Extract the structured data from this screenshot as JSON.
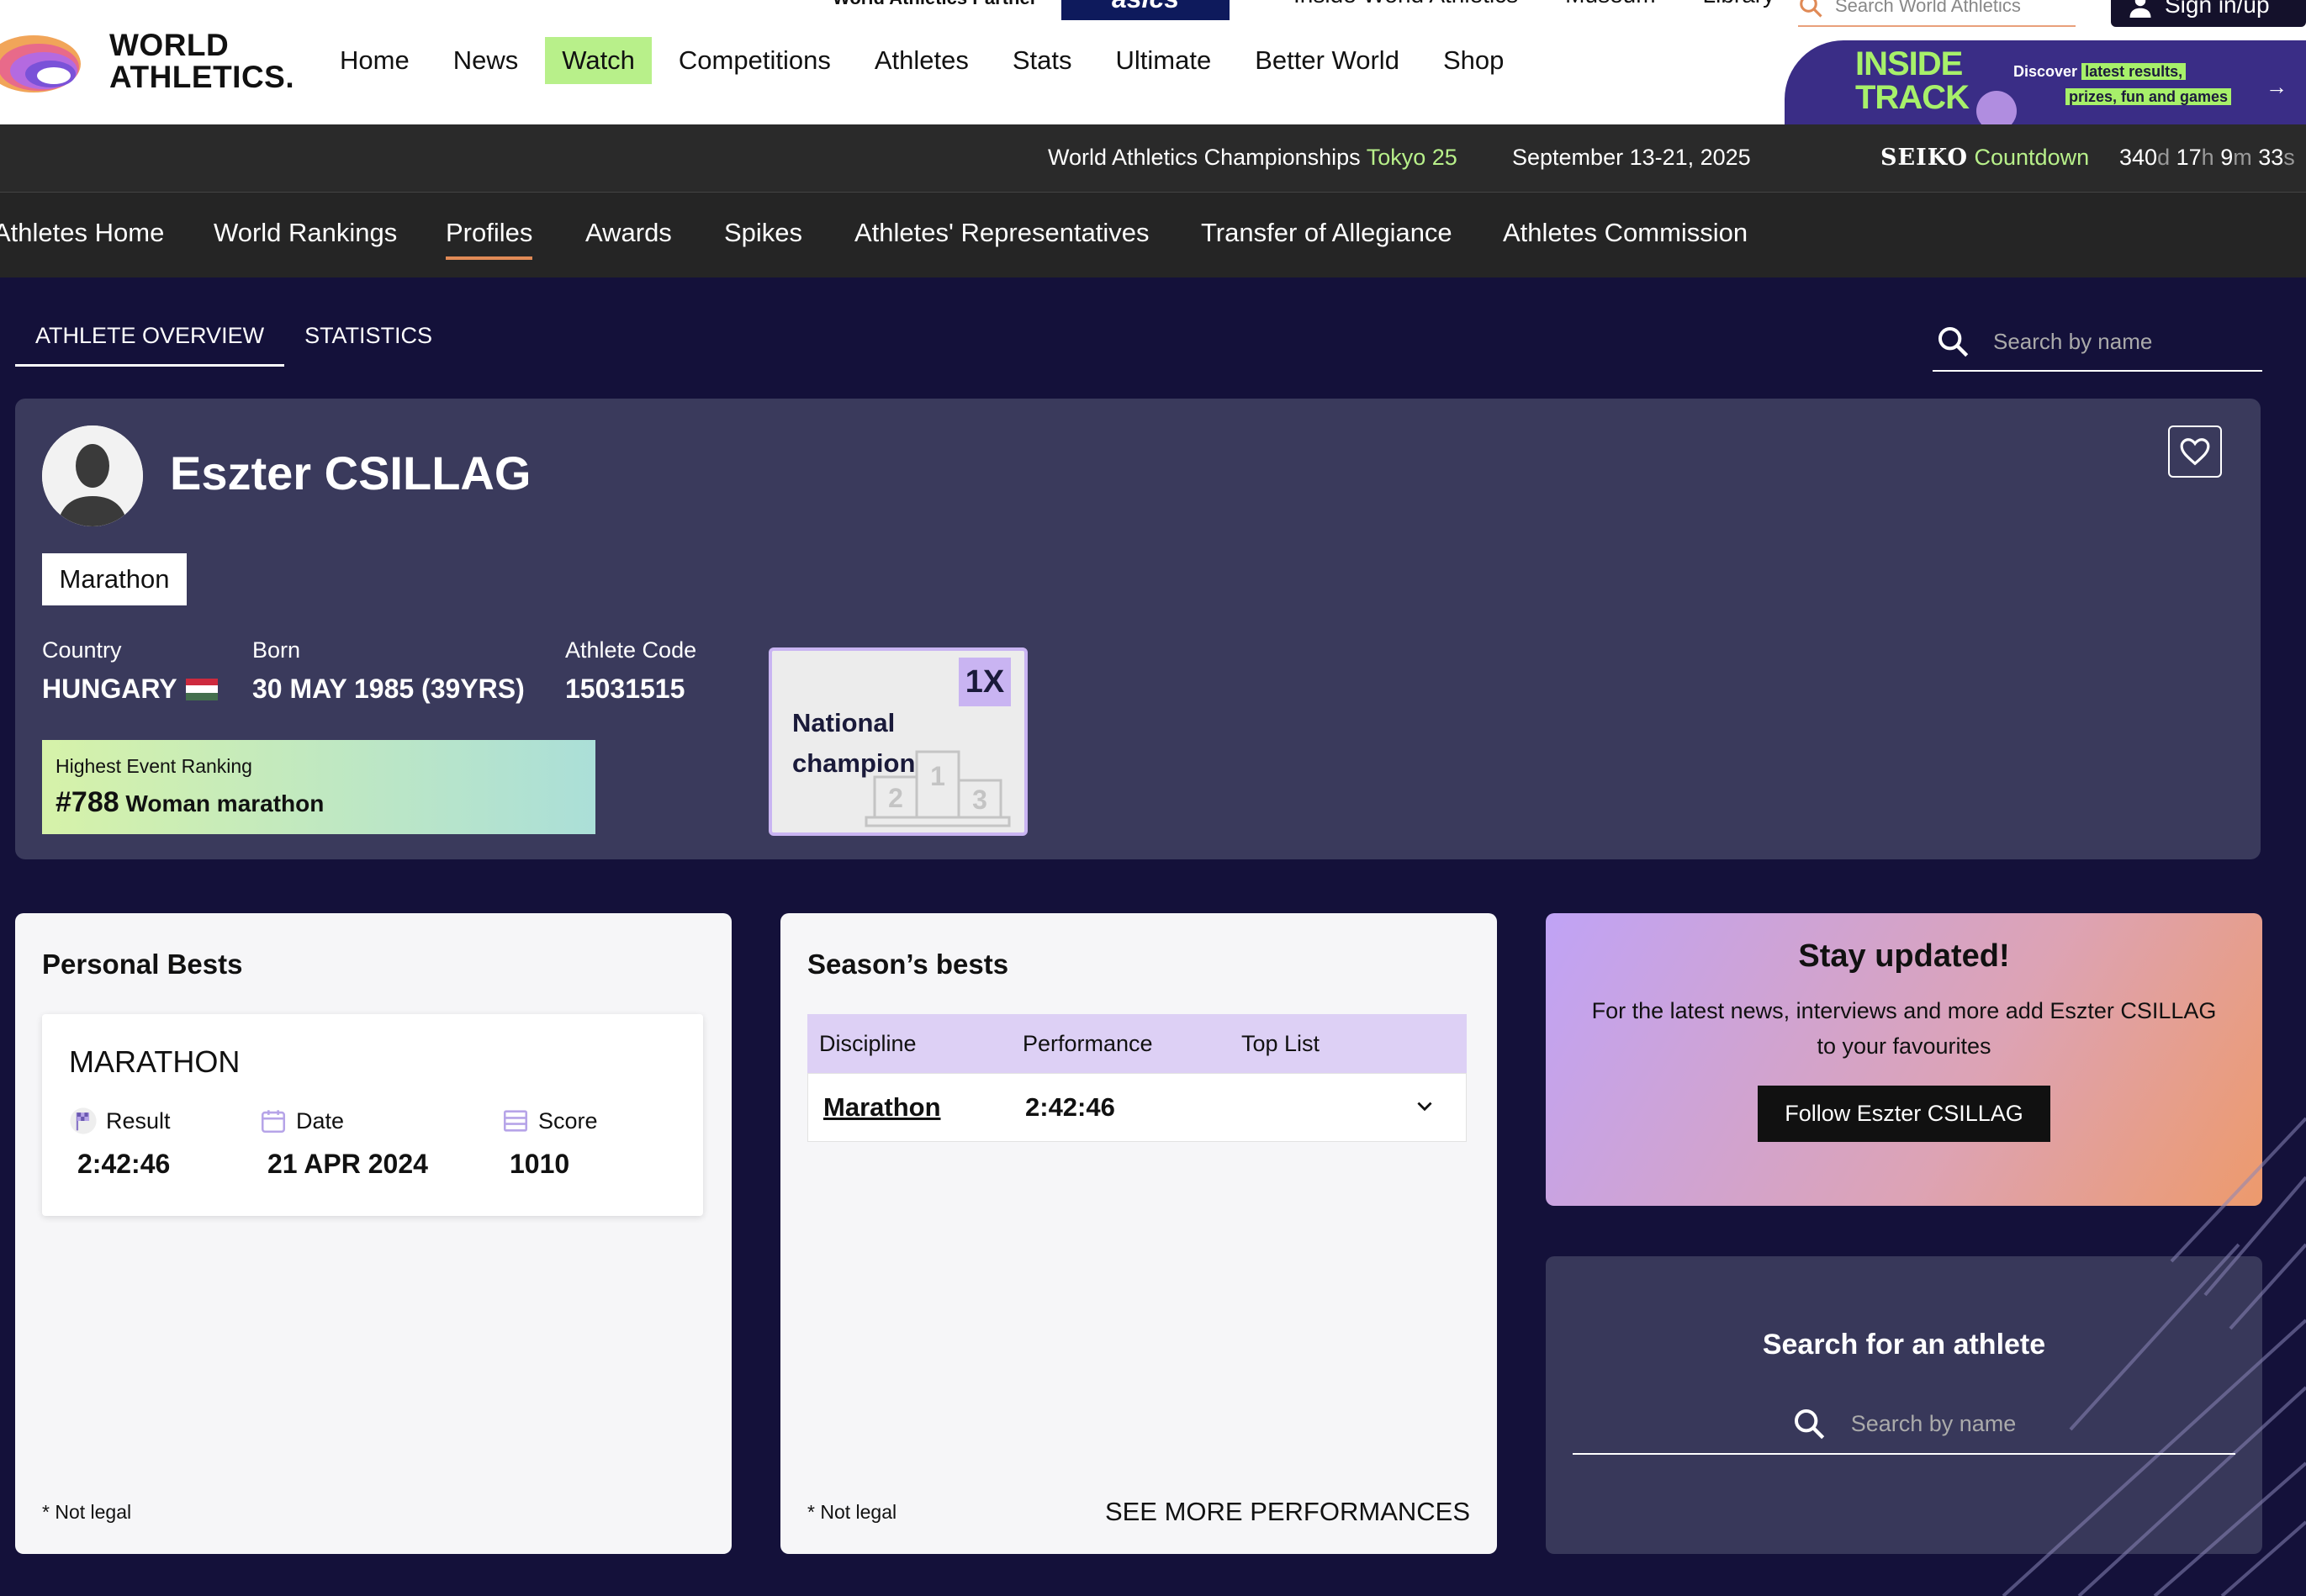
{
  "header": {
    "logo_line1": "WORLD",
    "logo_line2": "ATHLETICS.",
    "partner_label": "World Athletics Partner",
    "partner_logo": "asics",
    "util_links": [
      "Inside World Athletics",
      "Museum",
      "Library"
    ],
    "search_placeholder": "Search World Athletics",
    "sign_in_label": "Sign in/up",
    "nav": [
      "Home",
      "News",
      "Watch",
      "Competitions",
      "Athletes",
      "Stats",
      "Ultimate",
      "Better World",
      "Shop"
    ],
    "active_nav": "Watch",
    "promo": {
      "title_line1": "INSIDE",
      "title_line2": "TRACK",
      "text_prefix": "Discover",
      "text_hl1": "latest results,",
      "text_hl2": "prizes, fun and games",
      "arrow": "→"
    }
  },
  "countdown": {
    "event_prefix": "World Athletics Championships",
    "event_city": "Tokyo 25",
    "dates": "September 13-21, 2025",
    "brand": "SEIKO",
    "label": "Countdown",
    "days": "340",
    "hours": "17",
    "minutes": "9",
    "seconds": "33",
    "units": {
      "d": "d",
      "h": "h",
      "m": "m",
      "s": "s"
    }
  },
  "subnav": [
    "Athletes Home",
    "World Rankings",
    "Profiles",
    "Awards",
    "Spikes",
    "Athletes' Representatives",
    "Transfer of Allegiance",
    "Athletes Commission"
  ],
  "subnav_active": "Profiles",
  "tabs": [
    "ATHLETE OVERVIEW",
    "STATISTICS"
  ],
  "tab_active": "ATHLETE OVERVIEW",
  "top_search_placeholder": "Search by name",
  "athlete": {
    "name": "Eszter CSILLAG",
    "discipline": "Marathon",
    "country_label": "Country",
    "country": "HUNGARY",
    "born_label": "Born",
    "born": "30 MAY 1985 (39YRS)",
    "code_label": "Athlete Code",
    "code": "15031515",
    "ranking_label": "Highest Event Ranking",
    "ranking_num": "#788",
    "ranking_event": "Woman marathon",
    "honour_count": "1X",
    "honour_title_1": "National",
    "honour_title_2": "champion",
    "podium": [
      "2",
      "1",
      "3"
    ],
    "flag_colors": [
      "#cd2a3e",
      "#ffffff",
      "#436f4d"
    ]
  },
  "personal_bests": {
    "title": "Personal Bests",
    "event": "MARATHON",
    "result_label": "Result",
    "result": "2:42:46",
    "date_label": "Date",
    "date": "21 APR 2024",
    "score_label": "Score",
    "score": "1010",
    "footnote": "* Not legal"
  },
  "season_bests": {
    "title": "Season’s bests",
    "columns": [
      "Discipline",
      "Performance",
      "Top List"
    ],
    "rows": [
      {
        "discipline": "Marathon",
        "performance": "2:42:46"
      }
    ],
    "footnote": "* Not legal",
    "more_label": "SEE MORE PERFORMANCES"
  },
  "stay_updated": {
    "title": "Stay updated!",
    "text": "For the latest news, interviews and more add Eszter CSILLAG to your favourites",
    "button": "Follow Eszter CSILLAG"
  },
  "search_athlete": {
    "title": "Search for an athlete",
    "placeholder": "Search by name"
  },
  "colors": {
    "page_bg": "#14113a",
    "card_bg": "#3a3a5c",
    "accent_green": "#b8f08a",
    "accent_orange": "#e08a56",
    "lavender": "#c9b4f2"
  }
}
